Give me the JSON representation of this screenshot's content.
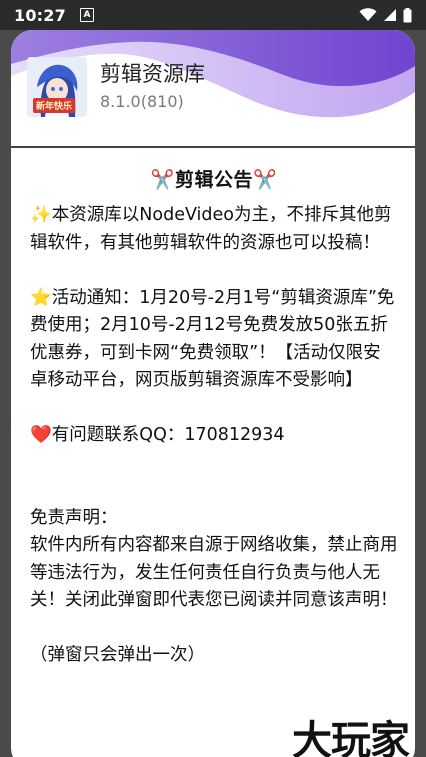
{
  "status_bar": {
    "time": "10:27",
    "notification_icon": "a-icon",
    "icons": [
      "wifi-icon",
      "signal-icon",
      "battery-icon"
    ]
  },
  "app": {
    "name": "剪辑资源库",
    "version": "8.1.0(810)",
    "icon_badge": "新年快乐"
  },
  "notice": {
    "title": "剪辑公告",
    "title_icon": "✂️",
    "paragraphs": [
      {
        "emoji": "✨",
        "text": "本资源库以NodeVideo为主，不排斥其他剪辑软件，有其他剪辑软件的资源也可以投稿！"
      },
      {
        "emoji": "⭐",
        "text": "活动通知：1月20号-2月1号“剪辑资源库”免费使用；2月10号-2月12号免费发放50张五折优惠券，可到卡网“免费领取”！【活动仅限安卓移动平台，网页版剪辑资源库不受影响】"
      },
      {
        "emoji": "❤️",
        "text": "有问题联系QQ：170812934"
      },
      {
        "emoji": "",
        "text": "免责声明：\n软件内所有内容都来自源于网络收集，禁止商用等违法行为，发生任何责任自行负责与他人无关！关闭此弹窗即代表您已阅读并同意该声明！"
      }
    ],
    "footnote": "（弹窗只会弹出一次）"
  },
  "watermark": "大玩家",
  "colors": {
    "wave_dark": "#7b4fd6",
    "wave_light": "#c9b2f2",
    "status_bar_bg": "#2a2a2a",
    "accent_red": "#d11f2a"
  }
}
